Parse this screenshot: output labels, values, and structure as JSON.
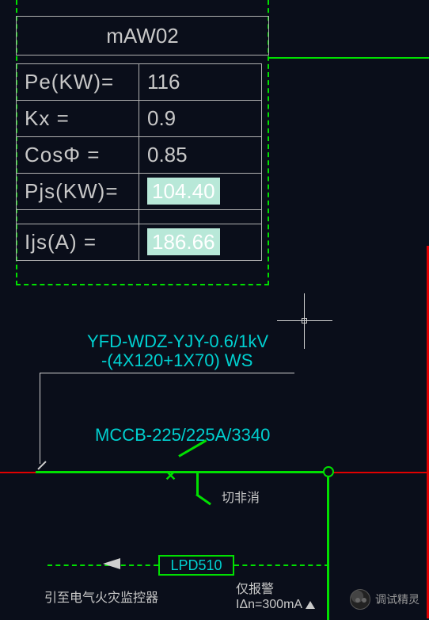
{
  "panel": {
    "title": "mAW02",
    "rows": [
      {
        "label": "Pe(KW)=",
        "value": "116",
        "highlight": false
      },
      {
        "label": "Kx      =",
        "value": "0.9",
        "highlight": false
      },
      {
        "label": "CosΦ  =",
        "value": "0.85",
        "highlight": false
      },
      {
        "label": "Pjs(KW)=",
        "value": "104.40",
        "highlight": true
      },
      {
        "label": "Ijs(A)   =",
        "value": "186.66",
        "highlight": true
      }
    ]
  },
  "cable": {
    "line1": "YFD-WDZ-YJY-0.6/1kV",
    "line2": "-(4X120+1X70) WS"
  },
  "breaker": {
    "label": "MCCB-225/225A/3340",
    "switch_note": "切非消"
  },
  "device": {
    "name": "LPD510"
  },
  "notes": {
    "left": "引至电气火灾监控器",
    "right_top": "仅报警",
    "right_bottom": "IΔn=300mA"
  },
  "watermark": "调试精灵",
  "chart_data": {
    "type": "table",
    "title": "mAW02",
    "rows": [
      {
        "param": "Pe(KW)",
        "value": 116
      },
      {
        "param": "Kx",
        "value": 0.9
      },
      {
        "param": "CosΦ",
        "value": 0.85
      },
      {
        "param": "Pjs(KW)",
        "value": 104.4
      },
      {
        "param": "Ijs(A)",
        "value": 186.66
      }
    ],
    "annotations": {
      "cable": "YFD-WDZ-YJY-0.6/1kV -(4X120+1X70) WS",
      "breaker": "MCCB-225/225A/3340",
      "breaker_note": "切非消",
      "device": "LPD510",
      "device_note_left": "引至电气火灾监控器",
      "device_note_right": "仅报警 IΔn=300mA"
    }
  }
}
